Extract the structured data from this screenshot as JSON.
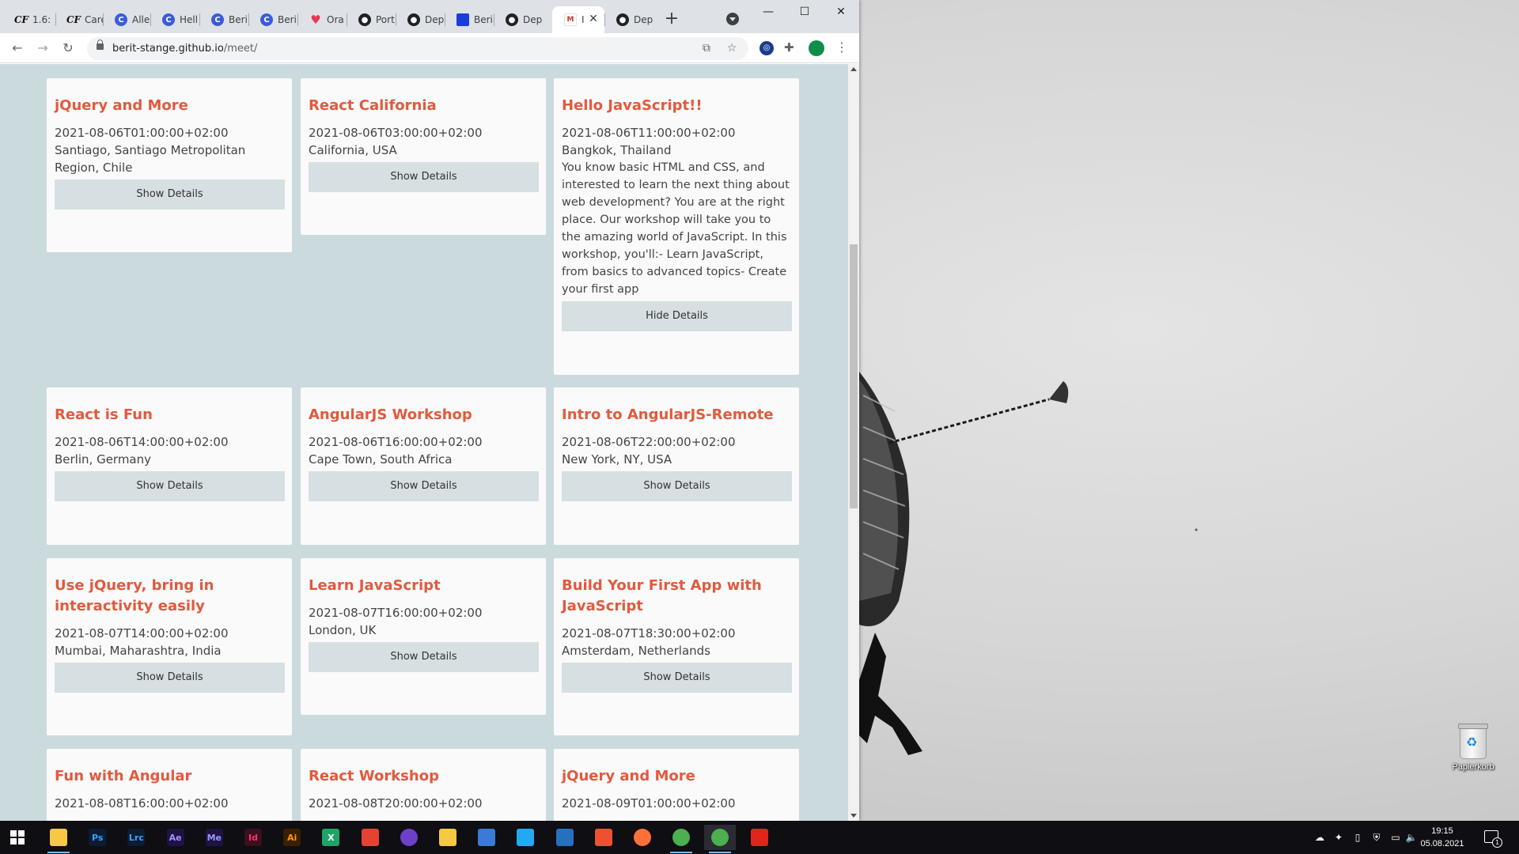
{
  "browser": {
    "tabs": [
      {
        "icon": "cf-icon",
        "title": "1.6:"
      },
      {
        "icon": "cf-icon",
        "title": "Care"
      },
      {
        "icon": "c-icon",
        "title": "Alle"
      },
      {
        "icon": "c-icon",
        "title": "Hell"
      },
      {
        "icon": "c-icon",
        "title": "Beri"
      },
      {
        "icon": "c-icon",
        "title": "Beri"
      },
      {
        "icon": "pocket-icon",
        "title": "Ora"
      },
      {
        "icon": "github-icon",
        "title": "Port"
      },
      {
        "icon": "github-icon",
        "title": "Dep"
      },
      {
        "icon": "square-icon",
        "title": "Beri"
      },
      {
        "icon": "github-icon",
        "title": "Dep"
      },
      {
        "icon": "gmail-icon",
        "title": "I"
      },
      {
        "icon": "github-icon",
        "title": "Dep"
      }
    ],
    "new_tab_label": "+",
    "url_host": "berit-stange.github.io",
    "url_path": "/meet/"
  },
  "events": [
    {
      "name": "jQuery and More",
      "date": "2021-08-06T01:00:00+02:00",
      "location": "Santiago, Santiago Metropolitan Region, Chile",
      "button": "Show Details"
    },
    {
      "name": "React California",
      "date": "2021-08-06T03:00:00+02:00",
      "location": "California, USA",
      "button": "Show Details"
    },
    {
      "name": "Hello JavaScript!!",
      "date": "2021-08-06T11:00:00+02:00",
      "location": "Bangkok, Thailand",
      "description": "You know basic HTML and CSS, and interested to learn the next thing about web development? You are at the right place. Our workshop will take you to the amazing world of JavaScript. In this workshop, you'll:- Learn JavaScript, from basics to advanced topics- Create your first app",
      "button": "Hide Details"
    },
    {
      "name": "React is Fun",
      "date": "2021-08-06T14:00:00+02:00",
      "location": "Berlin, Germany",
      "button": "Show Details"
    },
    {
      "name": "AngularJS Workshop",
      "date": "2021-08-06T16:00:00+02:00",
      "location": "Cape Town, South Africa",
      "button": "Show Details"
    },
    {
      "name": "Intro to AngularJS-Remote",
      "date": "2021-08-06T22:00:00+02:00",
      "location": "New York, NY, USA",
      "button": "Show Details"
    },
    {
      "name": "Use jQuery, bring in interactivity easily",
      "date": "2021-08-07T14:00:00+02:00",
      "location": "Mumbai, Maharashtra, India",
      "button": "Show Details"
    },
    {
      "name": "Learn JavaScript",
      "date": "2021-08-07T16:00:00+02:00",
      "location": "London, UK",
      "button": "Show Details"
    },
    {
      "name": "Build Your First App with JavaScript",
      "date": "2021-08-07T18:30:00+02:00",
      "location": "Amsterdam, Netherlands",
      "button": "Show Details"
    },
    {
      "name": "Fun with Angular",
      "date": "2021-08-08T16:00:00+02:00"
    },
    {
      "name": "React Workshop",
      "date": "2021-08-08T20:00:00+02:00"
    },
    {
      "name": "jQuery and More",
      "date": "2021-08-09T01:00:00+02:00"
    }
  ],
  "desktop": {
    "recycle_bin_label": "Papierkorb"
  },
  "taskbar": {
    "apps": [
      {
        "name": "file-explorer-icon",
        "label": "",
        "color": "#f7c843"
      },
      {
        "name": "photoshop-icon",
        "label": "Ps",
        "color": "#31a8ff"
      },
      {
        "name": "lightroom-classic-icon",
        "label": "Lrc",
        "color": "#31a8ff"
      },
      {
        "name": "after-effects-icon",
        "label": "Ae",
        "color": "#9999ff"
      },
      {
        "name": "media-encoder-icon",
        "label": "Me",
        "color": "#9999ff"
      },
      {
        "name": "indesign-icon",
        "label": "Id",
        "color": "#ff3366"
      },
      {
        "name": "illustrator-icon",
        "label": "Ai",
        "color": "#ff9a00"
      },
      {
        "name": "excel-icon",
        "label": "X",
        "color": "#21a366"
      },
      {
        "name": "todoist-icon",
        "label": "",
        "color": "#e44332"
      },
      {
        "name": "github-desktop-icon",
        "label": "",
        "color": "#6e40c9"
      },
      {
        "name": "sticky-icon",
        "label": "",
        "color": "#f7c843"
      },
      {
        "name": "app-icon",
        "label": "",
        "color": "#3a7bd5"
      },
      {
        "name": "vscode-icon",
        "label": "",
        "color": "#23a9f2"
      },
      {
        "name": "powershell-icon",
        "label": "",
        "color": "#2671be"
      },
      {
        "name": "git-icon",
        "label": "",
        "color": "#f05032"
      },
      {
        "name": "firefox-icon",
        "label": "",
        "color": "#ff7139"
      },
      {
        "name": "chrome-icon",
        "label": "",
        "color": "#4caf50"
      },
      {
        "name": "chrome-active-icon",
        "label": "",
        "color": "#4caf50"
      },
      {
        "name": "acrobat-icon",
        "label": "",
        "color": "#e0251b"
      }
    ],
    "time": "19:15",
    "date": "05.08.2021",
    "notification_count": "1"
  }
}
